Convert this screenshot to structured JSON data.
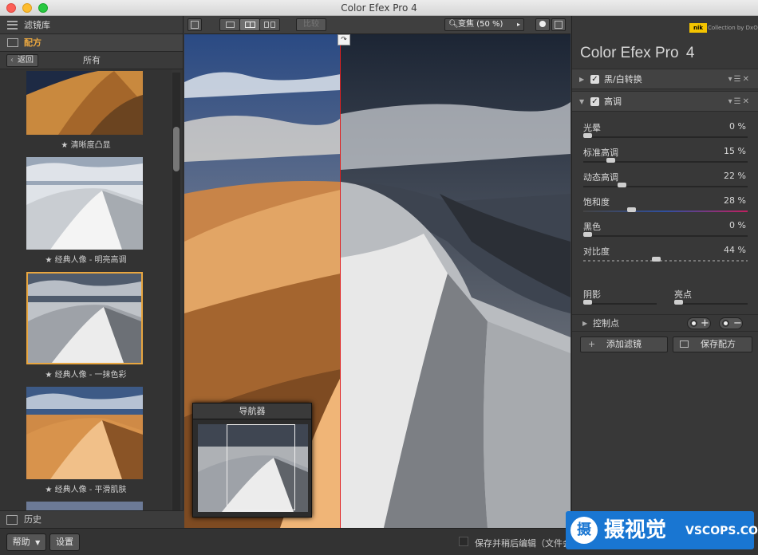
{
  "window": {
    "title": "Color Efex Pro 4"
  },
  "left": {
    "library_label": "滤镜库",
    "recipes_label": "配方",
    "back_label": "返回",
    "all_label": "所有",
    "presets": [
      {
        "label": "★ 清晰度凸显"
      },
      {
        "label": "★ 经典人像 - 明亮高调"
      },
      {
        "label": "★ 经典人像 - 一抹色彩"
      },
      {
        "label": "★ 经典人像 - 平滑肌肤"
      }
    ],
    "history_label": "历史"
  },
  "toolbar": {
    "compare_label": "比较",
    "zoom_label": "变焦 (50 %)"
  },
  "navigator": {
    "title": "导航器"
  },
  "right": {
    "nik_label": "nik",
    "collection_label": "Collection by DxO",
    "product_name": "Color Efex Pro",
    "product_version": "4",
    "filters": [
      {
        "name": "黑/白转换",
        "checked": true,
        "expanded": false
      },
      {
        "name": "高调",
        "checked": true,
        "expanded": true
      }
    ],
    "params": [
      {
        "name": "光晕",
        "value": "0 %",
        "level": 0.0
      },
      {
        "name": "标准高调",
        "value": "15 %",
        "level": 0.15
      },
      {
        "name": "动态高调",
        "value": "22 %",
        "level": 0.22
      },
      {
        "name": "饱和度",
        "value": "28 %",
        "level": 0.28
      },
      {
        "name": "黑色",
        "value": "0 %",
        "level": 0.0
      },
      {
        "name": "对比度",
        "value": "44 %",
        "level": 0.44
      }
    ],
    "shadow_label": "阴影",
    "highlight_label": "亮点",
    "control_points_label": "控制点",
    "add_filter_label": "添加滤镜",
    "save_recipe_label": "保存配方"
  },
  "bottom": {
    "help_label": "帮助",
    "settings_label": "设置",
    "save_note": "保存并稍后编辑（文件会"
  },
  "watermark": {
    "logo_char": "摄",
    "text": "摄视觉",
    "site": "VSCOPS.COM"
  },
  "colors": {
    "accent": "#e8a640",
    "split_line": "#e02020",
    "watermark_bg": "#1976d2"
  }
}
